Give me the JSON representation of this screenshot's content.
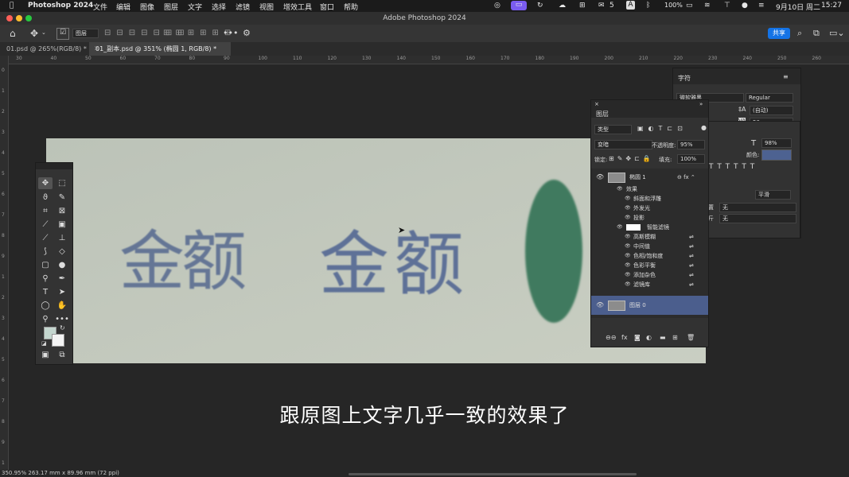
{
  "menubar": {
    "apple": "",
    "app": "Photoshop 2024",
    "items": [
      "文件",
      "编辑",
      "图像",
      "图层",
      "文字",
      "选择",
      "滤镜",
      "视图",
      "增效工具",
      "窗口",
      "帮助"
    ],
    "wechat_count": "5",
    "input": "A",
    "battery": "100%",
    "date": "9月10日 周二",
    "time": "15:27"
  },
  "title": "Adobe Photoshop 2024",
  "options": {
    "layer_select": "图层",
    "share": "共享"
  },
  "tabs": [
    "01.psd @ 265%(RGB/8) *",
    "01_副本.psd @ 351% (椭圆 1, RGB/8) *"
  ],
  "ruler_top": [
    "30",
    "40",
    "50",
    "60",
    "70",
    "80",
    "90",
    "100",
    "110",
    "120",
    "130",
    "140",
    "150",
    "160",
    "170",
    "180",
    "190",
    "200",
    "210",
    "220",
    "230",
    "240",
    "250",
    "260"
  ],
  "ruler_left": [
    "0",
    "1",
    "2",
    "3",
    "4",
    "5",
    "6",
    "7",
    "8",
    "9",
    "1",
    "2",
    "3",
    "4",
    "5",
    "6",
    "7",
    "8",
    "9",
    "1"
  ],
  "canvas_text": {
    "left": "金额",
    "right": "金额"
  },
  "character": {
    "title": "字符",
    "font": "微软雅黑",
    "style": "Regular",
    "leading": "(自动)",
    "tracking": "50",
    "vscale": "98%",
    "color_label": "颜色:",
    "aa": "平滑",
    "lang_label1": "置",
    "lang_value1": "无",
    "lang_label2": "斤",
    "lang_value2": "无"
  },
  "layers": {
    "title": "图层",
    "filter": "类型",
    "blend": "变暗",
    "opacity_label": "不透明度:",
    "opacity": "95%",
    "lock_label": "锁定:",
    "fill_label": "填充:",
    "fill": "100%",
    "items": [
      {
        "name": "椭圆 1",
        "kind": "layer"
      },
      {
        "name": "效果",
        "kind": "effects"
      },
      {
        "name": "斜面和浮雕",
        "kind": "fx"
      },
      {
        "name": "外发光",
        "kind": "fx"
      },
      {
        "name": "投影",
        "kind": "fx"
      },
      {
        "name": "智能滤镜",
        "kind": "smart"
      },
      {
        "name": "高斯模糊",
        "kind": "filter"
      },
      {
        "name": "中间值",
        "kind": "filter"
      },
      {
        "name": "色相/饱和度",
        "kind": "filter"
      },
      {
        "name": "色彩平衡",
        "kind": "filter"
      },
      {
        "name": "添加杂色",
        "kind": "filter"
      },
      {
        "name": "滤镜库",
        "kind": "filter"
      },
      {
        "name": "图层 0",
        "kind": "layer"
      }
    ]
  },
  "subtitle": "跟原图上文字几乎一致的效果了",
  "status": "350.95%   263.17 mm x 89.96 mm (72 ppi)",
  "colors": {
    "accent": "#1473e6",
    "selected_layer": "#4b5e8d",
    "ellipse": "#3f7a5e"
  }
}
